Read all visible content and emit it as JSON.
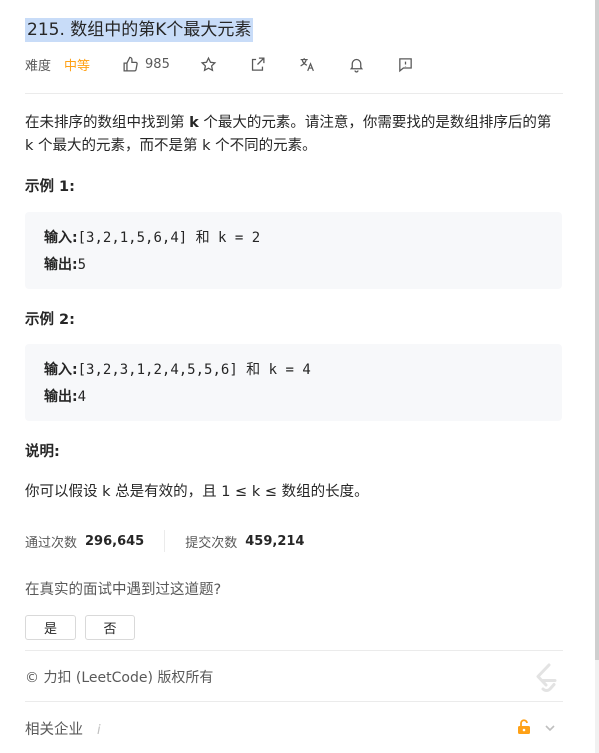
{
  "problem": {
    "title": "215. 数组中的第K个最大元素",
    "difficulty_label": "难度",
    "difficulty": "中等",
    "likes": "985"
  },
  "description": {
    "part1": "在未排序的数组中找到第 ",
    "k_bold": "k",
    "part2": " 个最大的元素。请注意，你需要找的是数组排序后的第 k 个最大的元素，而不是第 k 个不同的元素。"
  },
  "examples": [
    {
      "heading": "示例 1:",
      "input_label": "输入:",
      "input_value": "[3,2,1,5,6,4] 和 k = 2",
      "output_label": "输出:",
      "output_value": "5"
    },
    {
      "heading": "示例 2:",
      "input_label": "输入:",
      "input_value": "[3,2,3,1,2,4,5,5,6] 和 k = 4",
      "output_label": "输出:",
      "output_value": "4"
    }
  ],
  "note": {
    "heading": "说明:",
    "text": "你可以假设 k 总是有效的，且 1 ≤ k ≤ 数组的长度。"
  },
  "stats": {
    "accepted_label": "通过次数",
    "accepted_value": "296,645",
    "submissions_label": "提交次数",
    "submissions_value": "459,214"
  },
  "interview": {
    "question": "在真实的面试中遇到过这道题?",
    "yes": "是",
    "no": "否"
  },
  "footer": {
    "copyright": "© 力扣 (LeetCode) 版权所有",
    "related_companies": "相关企业",
    "info_mark": "i"
  },
  "colors": {
    "difficulty_medium": "#ffa116",
    "title_highlight": "#c8dcf8",
    "code_bg": "#f7f8fa",
    "lock": "#ffa116"
  }
}
